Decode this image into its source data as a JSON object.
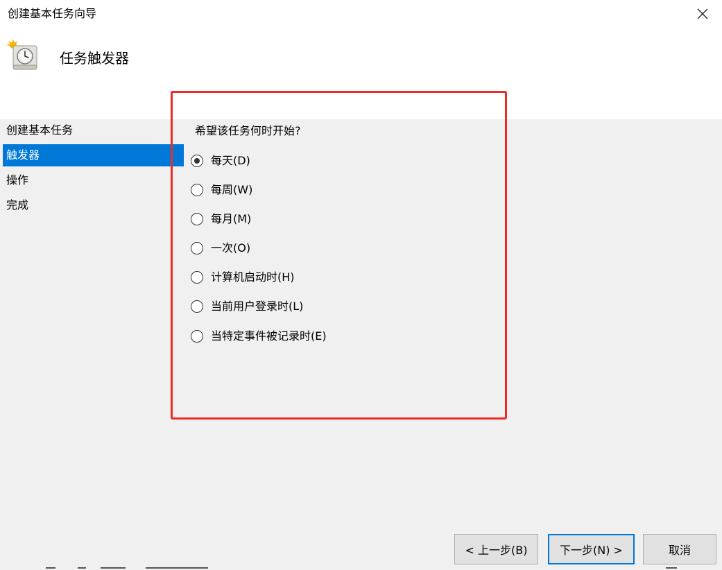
{
  "window": {
    "title": "创建基本任务向导",
    "close_icon": "close-icon"
  },
  "header": {
    "icon": "clock-task-icon",
    "title": "任务触发器"
  },
  "nav": {
    "items": [
      {
        "label": "创建基本任务",
        "active": false
      },
      {
        "label": "触发器",
        "active": true
      },
      {
        "label": "操作",
        "active": false
      },
      {
        "label": "完成",
        "active": false
      }
    ]
  },
  "main": {
    "question": "希望该任务何时开始?",
    "options": [
      {
        "label": "每天(D)",
        "selected": true
      },
      {
        "label": "每周(W)",
        "selected": false
      },
      {
        "label": "每月(M)",
        "selected": false
      },
      {
        "label": "一次(O)",
        "selected": false
      },
      {
        "label": "计算机启动时(H)",
        "selected": false
      },
      {
        "label": "当前用户登录时(L)",
        "selected": false
      },
      {
        "label": "当特定事件被记录时(E)",
        "selected": false
      }
    ]
  },
  "buttons": {
    "back_label": "< 上一步(B)",
    "next_label": "下一步(N) >",
    "cancel_label": "取消"
  },
  "colors": {
    "selection": "#0078d7",
    "highlight_box": "#ee2a24",
    "panel_bg": "#f0f0f0"
  }
}
